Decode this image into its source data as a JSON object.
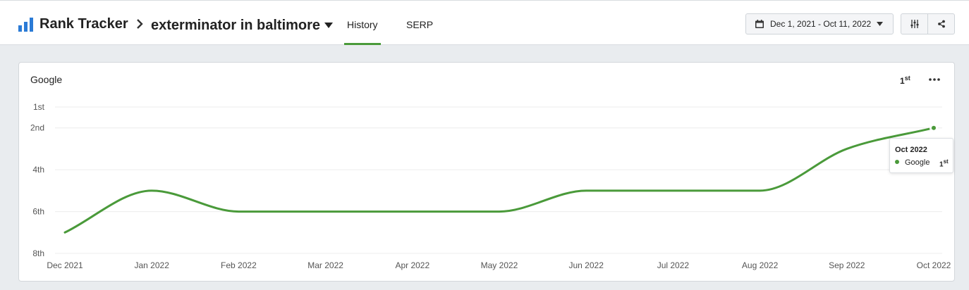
{
  "header": {
    "brand": "Rank Tracker",
    "keyword": "exterminator in baltimore",
    "tabs": [
      {
        "label": "History",
        "active": true
      },
      {
        "label": "SERP",
        "active": false
      }
    ],
    "date_range": "Dec 1, 2021 - Oct 11, 2022",
    "accent_color": "#4a9a3a",
    "brand_icon_color": "#2b7bd6"
  },
  "card": {
    "title": "Google",
    "current_rank": "1st",
    "menu_icon": "more-horizontal-icon"
  },
  "tooltip": {
    "title": "Oct 2022",
    "series": "Google",
    "value": "1st"
  },
  "chart_data": {
    "type": "line",
    "title": "Google",
    "xlabel": "",
    "ylabel": "",
    "categories": [
      "Dec 2021",
      "Jan 2022",
      "Feb 2022",
      "Mar 2022",
      "Apr 2022",
      "May 2022",
      "Jun 2022",
      "Jul 2022",
      "Aug 2022",
      "Sep 2022",
      "Oct 2022"
    ],
    "y_ticks": [
      {
        "value": 1,
        "label": "1st"
      },
      {
        "value": 2,
        "label": "2nd"
      },
      {
        "value": 4,
        "label": "4th"
      },
      {
        "value": 6,
        "label": "6th"
      },
      {
        "value": 8,
        "label": "8th"
      }
    ],
    "y_inverted": true,
    "grid": true,
    "series": [
      {
        "name": "Google",
        "color": "#4a9a3a",
        "values": [
          7,
          5,
          6,
          6,
          6,
          6,
          5,
          5,
          5,
          3,
          2
        ]
      }
    ]
  }
}
